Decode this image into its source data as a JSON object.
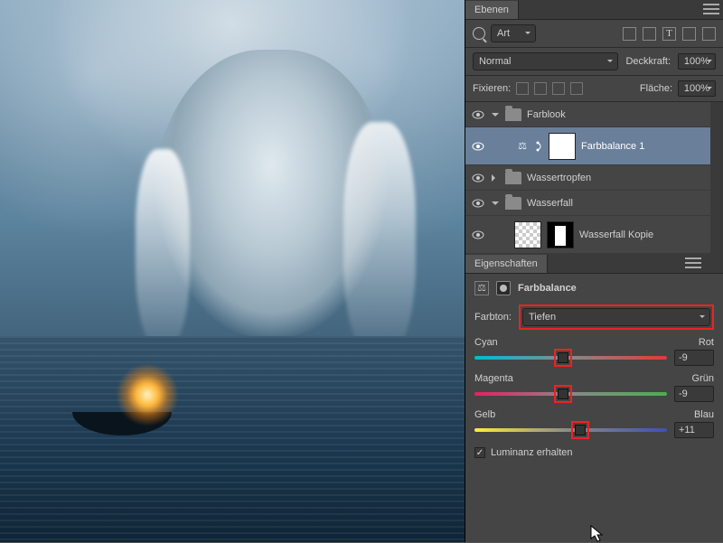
{
  "watermark": "",
  "panels": {
    "layers_tab": "Ebenen",
    "search_mode": "Art",
    "blend_mode": "Normal",
    "opacity_label": "Deckkraft:",
    "opacity_value": "100%",
    "lock_label": "Fixieren:",
    "fill_label": "Fläche:",
    "fill_value": "100%"
  },
  "layers": [
    {
      "name": "Farblook",
      "type": "group",
      "open": true
    },
    {
      "name": "Farbbalance 1",
      "type": "adj",
      "selected": true
    },
    {
      "name": "Wassertropfen",
      "type": "group",
      "open": false
    },
    {
      "name": "Wasserfall",
      "type": "group",
      "open": true
    },
    {
      "name": "Wasserfall Kopie",
      "type": "layer"
    }
  ],
  "properties": {
    "tab": "Eigenschaften",
    "title": "Farbbalance",
    "tone_label": "Farbton:",
    "tone_value": "Tiefen",
    "sliders": [
      {
        "left": "Cyan",
        "right": "Rot",
        "value": "-9",
        "pos": 46,
        "track": "t-cr"
      },
      {
        "left": "Magenta",
        "right": "Grün",
        "value": "-9",
        "pos": 46,
        "track": "t-mg"
      },
      {
        "left": "Gelb",
        "right": "Blau",
        "value": "+11",
        "pos": 55,
        "track": "t-yb"
      }
    ],
    "luminance": "Luminanz erhalten"
  }
}
